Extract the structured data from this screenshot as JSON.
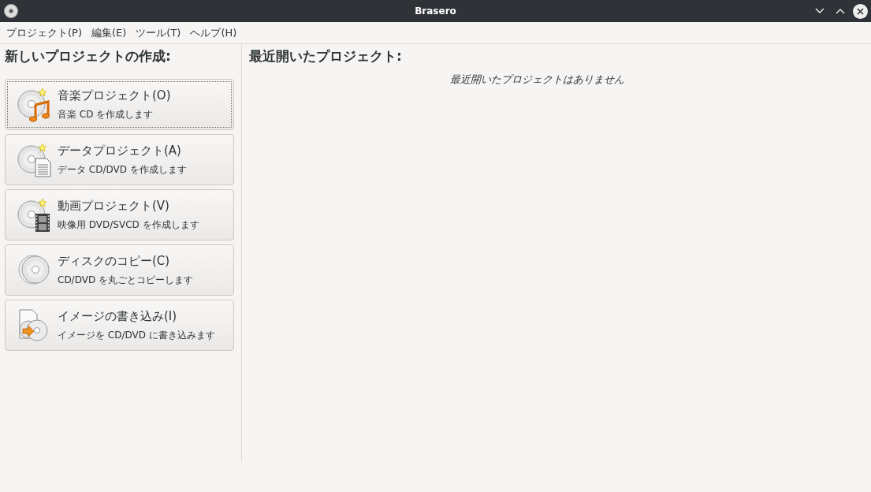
{
  "window": {
    "title": "Brasero"
  },
  "menu": [
    "プロジェクト(P)",
    "編集(E)",
    "ツール(T)",
    "ヘルプ(H)"
  ],
  "new_project": {
    "heading": "新しいプロジェクトの作成:",
    "items": [
      {
        "kind": "music",
        "title": "音楽プロジェクト(O)",
        "subtitle": "音楽 CD を作成します",
        "focused": true
      },
      {
        "kind": "data",
        "title": "データプロジェクト(A)",
        "subtitle": "データ CD/DVD を作成します",
        "focused": false
      },
      {
        "kind": "video",
        "title": "動画プロジェクト(V)",
        "subtitle": "映像用 DVD/SVCD を作成します",
        "focused": false
      },
      {
        "kind": "copy",
        "title": "ディスクのコピー(C)",
        "subtitle": "CD/DVD を丸ごとコピーします",
        "focused": false
      },
      {
        "kind": "image",
        "title": "イメージの書き込み(I)",
        "subtitle": "イメージを CD/DVD に書き込みます",
        "focused": false
      }
    ]
  },
  "recent": {
    "heading": "最近開いたプロジェクト:",
    "empty_message": "最近開いたプロジェクトはありません"
  }
}
